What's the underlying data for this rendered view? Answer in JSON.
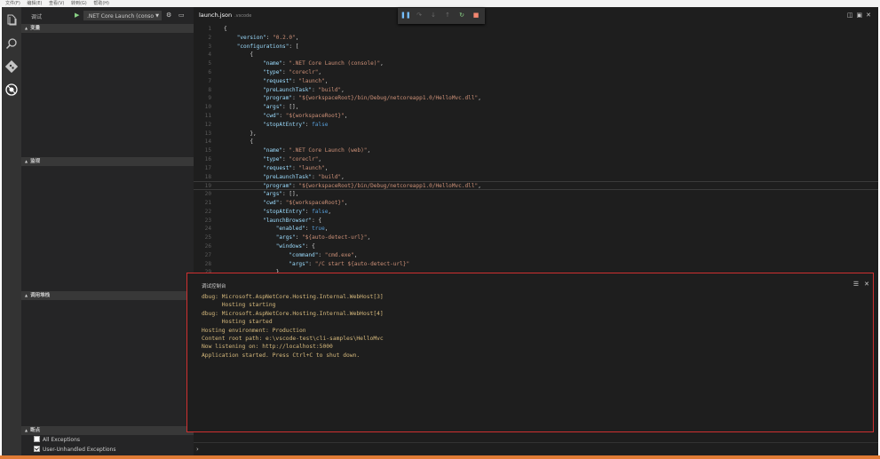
{
  "menu": [
    "文件(F)",
    "编辑(E)",
    "查看(V)",
    "转到(G)",
    "帮助(H)"
  ],
  "sidebar": {
    "title": "调试",
    "config": ".NET Core Launch (conso",
    "sections": {
      "variables": "变量",
      "watch": "监视",
      "callstack": "调用堆栈",
      "breakpoints": "断点"
    },
    "breakpoints": [
      {
        "label": "All Exceptions",
        "checked": false
      },
      {
        "label": "User-Unhandled Exceptions",
        "checked": true
      }
    ]
  },
  "editor": {
    "tab": {
      "name": "launch.json",
      "folder": ".vscode"
    },
    "lines": [
      [
        [
          "p",
          "{"
        ]
      ],
      [
        [
          "p",
          "    "
        ],
        [
          "key",
          "\"version\""
        ],
        [
          "p",
          ": "
        ],
        [
          "str",
          "\"0.2.0\""
        ],
        [
          "p",
          ","
        ]
      ],
      [
        [
          "p",
          "    "
        ],
        [
          "key",
          "\"configurations\""
        ],
        [
          "p",
          ": ["
        ]
      ],
      [
        [
          "p",
          "        {"
        ]
      ],
      [
        [
          "p",
          "            "
        ],
        [
          "key",
          "\"name\""
        ],
        [
          "p",
          ": "
        ],
        [
          "str",
          "\".NET Core Launch (console)\""
        ],
        [
          "p",
          ","
        ]
      ],
      [
        [
          "p",
          "            "
        ],
        [
          "key",
          "\"type\""
        ],
        [
          "p",
          ": "
        ],
        [
          "str",
          "\"coreclr\""
        ],
        [
          "p",
          ","
        ]
      ],
      [
        [
          "p",
          "            "
        ],
        [
          "key",
          "\"request\""
        ],
        [
          "p",
          ": "
        ],
        [
          "str",
          "\"launch\""
        ],
        [
          "p",
          ","
        ]
      ],
      [
        [
          "p",
          "            "
        ],
        [
          "key",
          "\"preLaunchTask\""
        ],
        [
          "p",
          ": "
        ],
        [
          "str",
          "\"build\""
        ],
        [
          "p",
          ","
        ]
      ],
      [
        [
          "p",
          "            "
        ],
        [
          "key",
          "\"program\""
        ],
        [
          "p",
          ": "
        ],
        [
          "str",
          "\"${workspaceRoot}/bin/Debug/netcoreapp1.0/HelloMvc.dll\""
        ],
        [
          "p",
          ","
        ]
      ],
      [
        [
          "p",
          "            "
        ],
        [
          "key",
          "\"args\""
        ],
        [
          "p",
          ": [],"
        ]
      ],
      [
        [
          "p",
          "            "
        ],
        [
          "key",
          "\"cwd\""
        ],
        [
          "p",
          ": "
        ],
        [
          "str",
          "\"${workspaceRoot}\""
        ],
        [
          "p",
          ","
        ]
      ],
      [
        [
          "p",
          "            "
        ],
        [
          "key",
          "\"stopAtEntry\""
        ],
        [
          "p",
          ": "
        ],
        [
          "kw",
          "false"
        ]
      ],
      [
        [
          "p",
          "        },"
        ]
      ],
      [
        [
          "p",
          "        {"
        ]
      ],
      [
        [
          "p",
          "            "
        ],
        [
          "key",
          "\"name\""
        ],
        [
          "p",
          ": "
        ],
        [
          "str",
          "\".NET Core Launch (web)\""
        ],
        [
          "p",
          ","
        ]
      ],
      [
        [
          "p",
          "            "
        ],
        [
          "key",
          "\"type\""
        ],
        [
          "p",
          ": "
        ],
        [
          "str",
          "\"coreclr\""
        ],
        [
          "p",
          ","
        ]
      ],
      [
        [
          "p",
          "            "
        ],
        [
          "key",
          "\"request\""
        ],
        [
          "p",
          ": "
        ],
        [
          "str",
          "\"launch\""
        ],
        [
          "p",
          ","
        ]
      ],
      [
        [
          "p",
          "            "
        ],
        [
          "key",
          "\"preLaunchTask\""
        ],
        [
          "p",
          ": "
        ],
        [
          "str",
          "\"build\""
        ],
        [
          "p",
          ","
        ]
      ],
      [
        [
          "p",
          "            "
        ],
        [
          "key",
          "\"program\""
        ],
        [
          "p",
          ": "
        ],
        [
          "str",
          "\"${workspaceRoot}/bin/Debug/netcoreapp1.0/HelloMvc.dll\""
        ],
        [
          "p",
          ","
        ]
      ],
      [
        [
          "p",
          "            "
        ],
        [
          "key",
          "\"args\""
        ],
        [
          "p",
          ": [],"
        ]
      ],
      [
        [
          "p",
          "            "
        ],
        [
          "key",
          "\"cwd\""
        ],
        [
          "p",
          ": "
        ],
        [
          "str",
          "\"${workspaceRoot}\""
        ],
        [
          "p",
          ","
        ]
      ],
      [
        [
          "p",
          "            "
        ],
        [
          "key",
          "\"stopAtEntry\""
        ],
        [
          "p",
          ": "
        ],
        [
          "kw",
          "false"
        ],
        [
          "p",
          ","
        ]
      ],
      [
        [
          "p",
          "            "
        ],
        [
          "key",
          "\"launchBrowser\""
        ],
        [
          "p",
          ": {"
        ]
      ],
      [
        [
          "p",
          "                "
        ],
        [
          "key",
          "\"enabled\""
        ],
        [
          "p",
          ": "
        ],
        [
          "kw",
          "true"
        ],
        [
          "p",
          ","
        ]
      ],
      [
        [
          "p",
          "                "
        ],
        [
          "key",
          "\"args\""
        ],
        [
          "p",
          ": "
        ],
        [
          "str",
          "\"${auto-detect-url}\""
        ],
        [
          "p",
          ","
        ]
      ],
      [
        [
          "p",
          "                "
        ],
        [
          "key",
          "\"windows\""
        ],
        [
          "p",
          ": {"
        ]
      ],
      [
        [
          "p",
          "                    "
        ],
        [
          "key",
          "\"command\""
        ],
        [
          "p",
          ": "
        ],
        [
          "str",
          "\"cmd.exe\""
        ],
        [
          "p",
          ","
        ]
      ],
      [
        [
          "p",
          "                    "
        ],
        [
          "key",
          "\"args\""
        ],
        [
          "p",
          ": "
        ],
        [
          "str",
          "\"/C start ${auto-detect-url}\""
        ]
      ],
      [
        [
          "p",
          "                },"
        ]
      ],
      [
        [
          "p",
          ""
        ]
      ]
    ],
    "current_line": 19
  },
  "console": {
    "title": "调试控制台",
    "lines": [
      "dbug: Microsoft.AspNetCore.Hosting.Internal.WebHost[3]",
      "      Hosting starting",
      "dbug: Microsoft.AspNetCore.Hosting.Internal.WebHost[4]",
      "      Hosting started",
      "Hosting environment: Production",
      "Content root path: e:\\vscode-test\\cli-samples\\HelloMvc",
      "Now listening on: http://localhost:5000",
      "Application started. Press Ctrl+C to shut down."
    ],
    "prompt": "›"
  },
  "colors": {
    "accent_orange": "#e07b35",
    "console_border": "#d03030",
    "console_text": "#d7ba7d"
  }
}
